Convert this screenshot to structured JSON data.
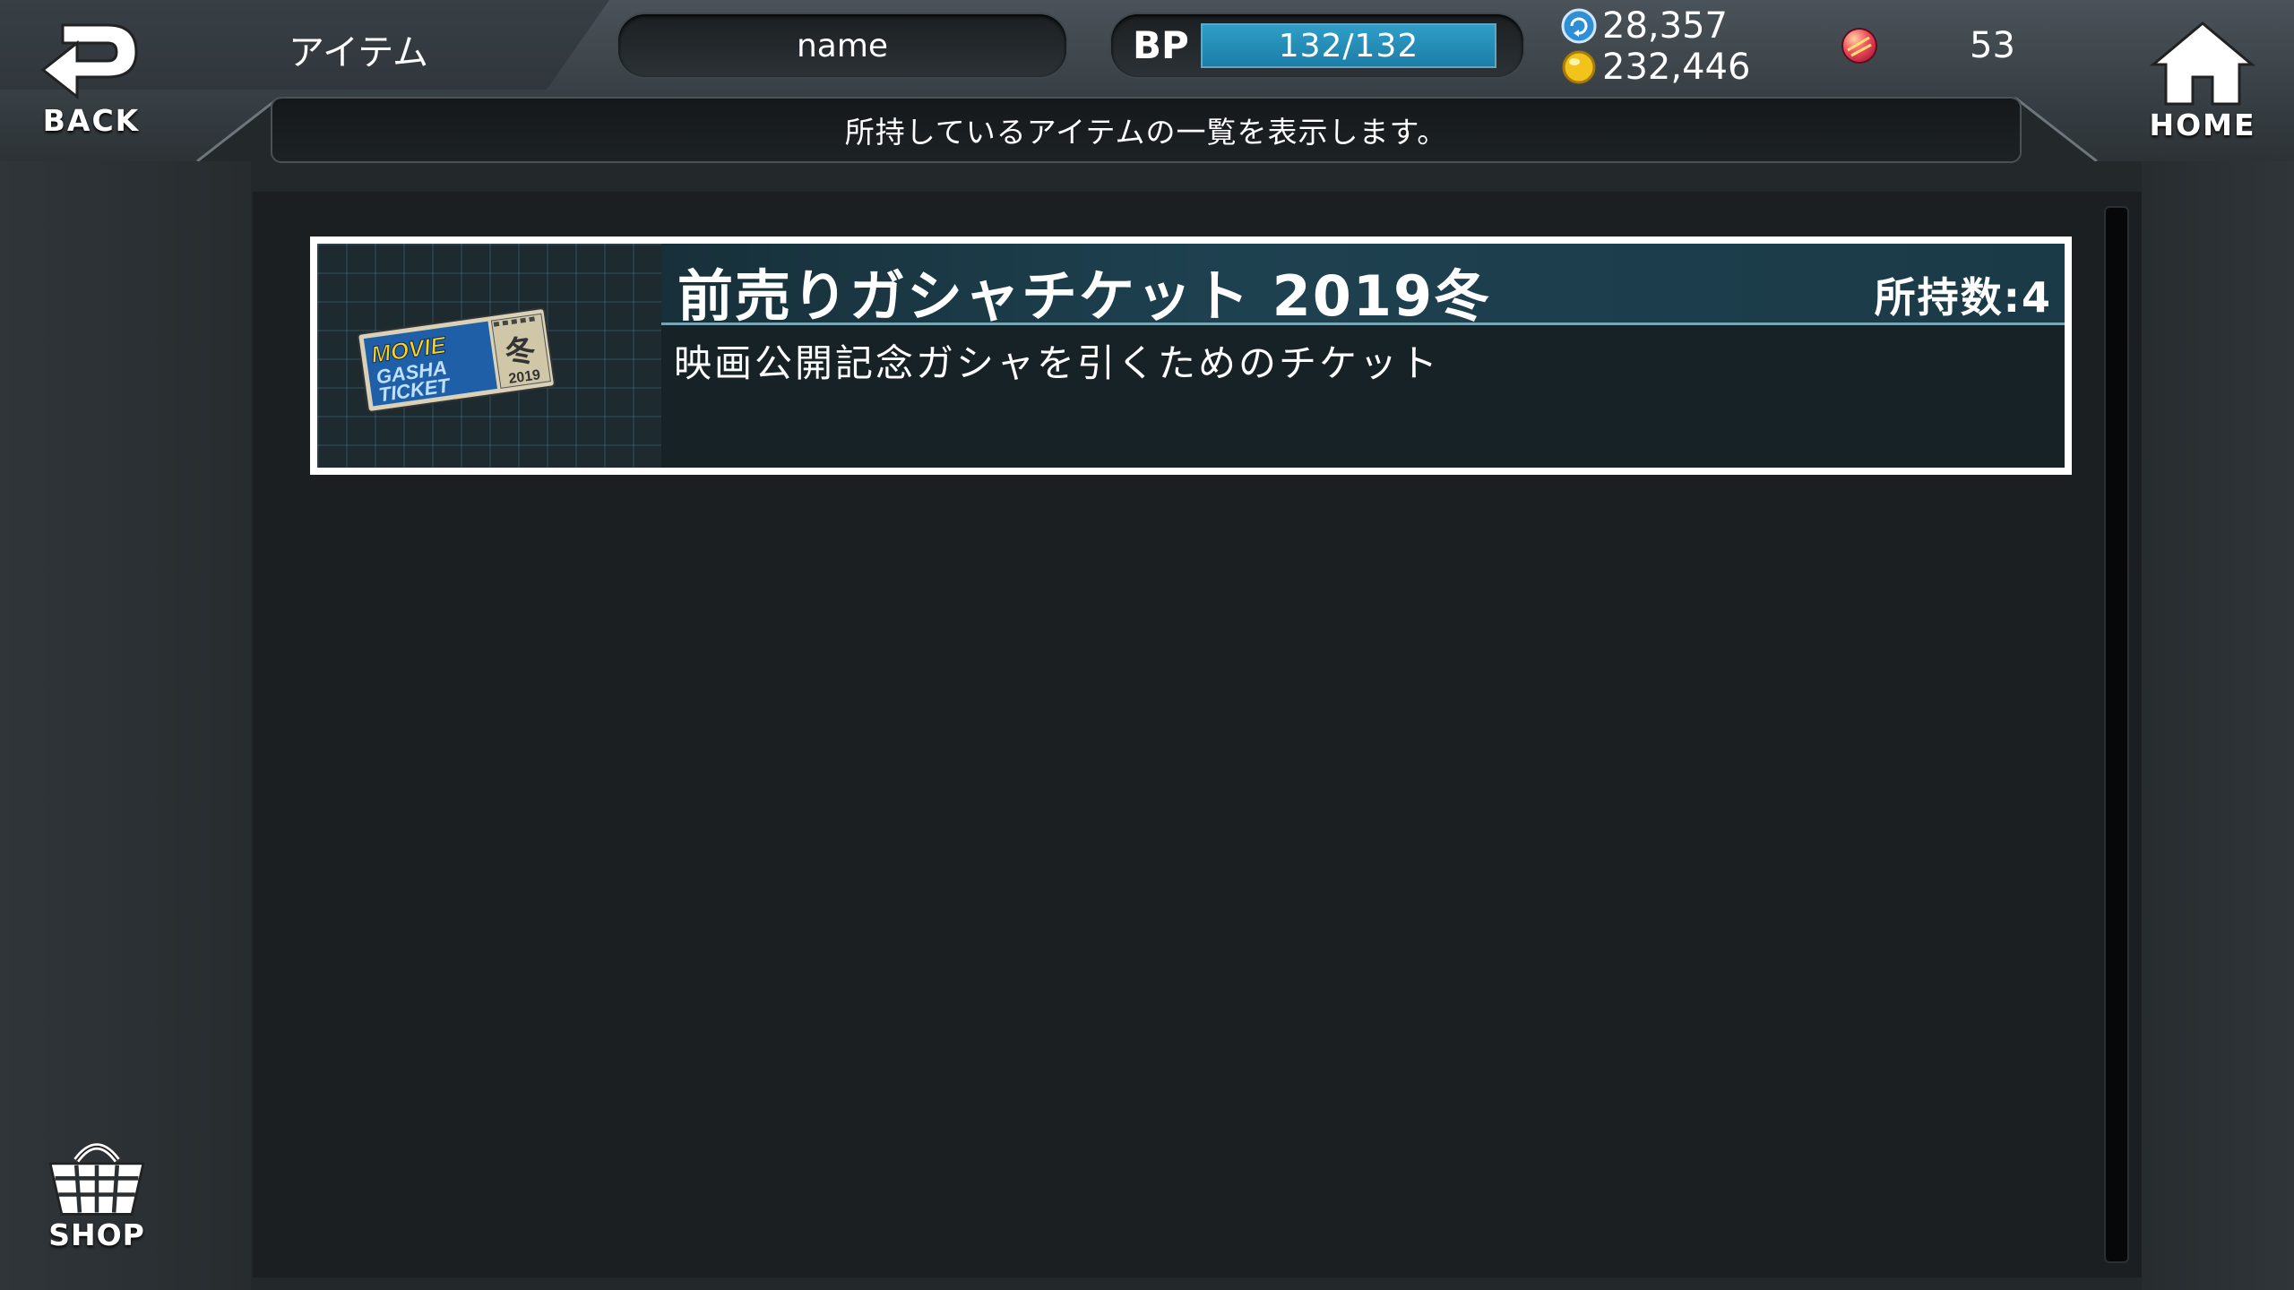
{
  "header": {
    "back_label": "BACK",
    "home_label": "HOME",
    "screen_title": "アイテム",
    "player_name": "name",
    "bp": {
      "label": "BP",
      "text": "132/132",
      "fill": 1.0
    },
    "currency_blue": "28,357",
    "currency_gold": "232,446",
    "gem_count": "53",
    "info_message": "所持しているアイテムの一覧を表示します。"
  },
  "items": [
    {
      "name": "前売りガシャチケット 2019冬",
      "count_text": "所持数:4",
      "description": "映画公開記念ガシャを引くためのチケット",
      "icon": "movie-gasha-ticket-icon",
      "icon_text": {
        "line1": "MOVIE",
        "line2": "GASHA",
        "line3": "TICKET",
        "stamp": "冬",
        "year": "2019"
      }
    }
  ],
  "footer": {
    "shop_label": "SHOP"
  },
  "colors": {
    "background": "#23282b",
    "panel": "#1b1f21",
    "bp_fill": "#2f9ec7",
    "item_header": "#1e4150",
    "coin_gold": "#f2c31b",
    "coin_blue": "#2e8fd6"
  }
}
